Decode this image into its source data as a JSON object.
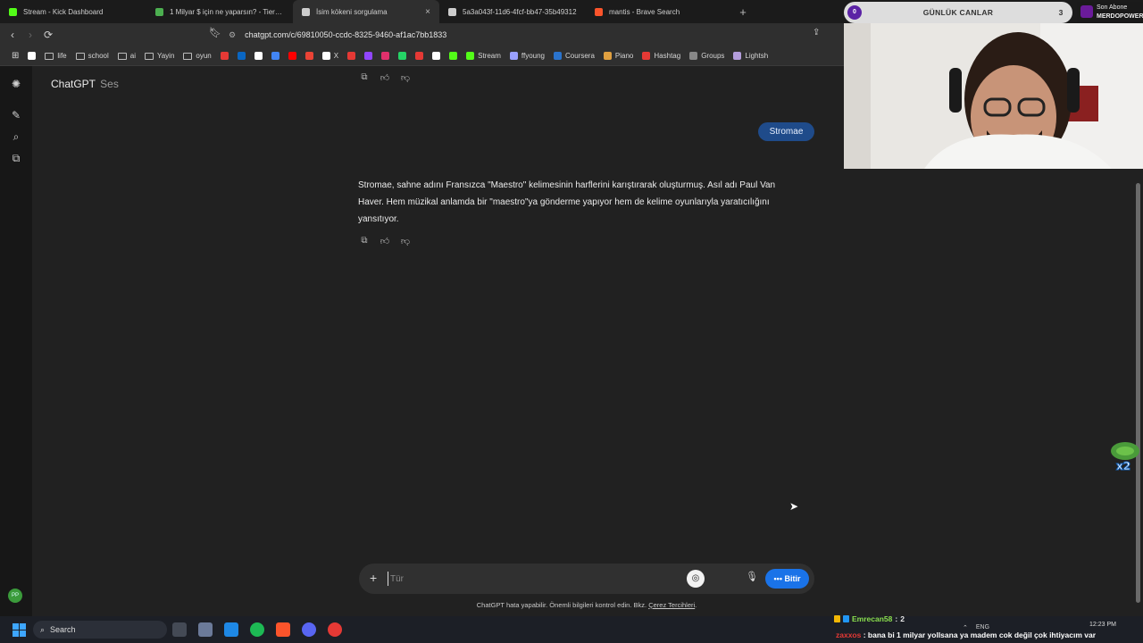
{
  "tabs": [
    {
      "label": "Stream - Kick Dashboard",
      "favicon_color": "#53fc18",
      "active": false
    },
    {
      "label": "1 Milyar $ için ne yaparsın? - Tier List",
      "favicon_color": "#4caf50",
      "active": false
    },
    {
      "label": "İsim kökeni sorgulama",
      "favicon_color": "#cccccc",
      "active": true
    },
    {
      "label": "5a3a043f-11d6-4fcf-bb47-35b49312",
      "favicon_color": "#cccccc",
      "active": false
    },
    {
      "label": "mantis - Brave Search",
      "favicon_color": "#fb542b",
      "active": false
    }
  ],
  "address_bar": {
    "url": "chatgpt.com/c/69810050-ccdc-8325-9460-af1ac7bb1833"
  },
  "bookmarks": [
    {
      "label": "",
      "icon": "google-icon",
      "color": "#ffffff"
    },
    {
      "label": "life",
      "icon": "folder-icon"
    },
    {
      "label": "school",
      "icon": "folder-icon"
    },
    {
      "label": "ai",
      "icon": "folder-icon"
    },
    {
      "label": "Yayin",
      "icon": "folder-icon"
    },
    {
      "label": "oyun",
      "icon": "folder-icon"
    },
    {
      "label": "",
      "icon": "red-dot-icon",
      "color": "#e53935"
    },
    {
      "label": "",
      "icon": "linkedin-icon",
      "color": "#0a66c2"
    },
    {
      "label": "",
      "icon": "google-icon",
      "color": "#ffffff"
    },
    {
      "label": "",
      "icon": "app-icon",
      "color": "#4285f4"
    },
    {
      "label": "",
      "icon": "youtube-icon",
      "color": "#ff0000"
    },
    {
      "label": "",
      "icon": "gmail-icon",
      "color": "#ea4335"
    },
    {
      "label": "X",
      "icon": "x-icon",
      "color": "#ffffff"
    },
    {
      "label": "",
      "icon": "red-icon",
      "color": "#e53935"
    },
    {
      "label": "",
      "icon": "twitch-icon",
      "color": "#9146ff"
    },
    {
      "label": "",
      "icon": "instagram-icon",
      "color": "#e1306c"
    },
    {
      "label": "",
      "icon": "whatsapp-icon",
      "color": "#25d366"
    },
    {
      "label": "",
      "icon": "tumblr-icon",
      "color": "#e53935"
    },
    {
      "label": "",
      "icon": "amazon-icon",
      "color": "#ffffff"
    },
    {
      "label": "",
      "icon": "kick-icon",
      "color": "#53fc18"
    },
    {
      "label": "Stream",
      "icon": "kick-icon",
      "color": "#53fc18"
    },
    {
      "label": "ffyoung",
      "icon": "app-icon",
      "color": "#9aa0ff"
    },
    {
      "label": "Coursera",
      "icon": "coursera-icon",
      "color": "#2a73cc"
    },
    {
      "label": "Piano",
      "icon": "app-icon",
      "color": "#e0a040"
    },
    {
      "label": "Hashtag",
      "icon": "red-icon",
      "color": "#e53935"
    },
    {
      "label": "Groups",
      "icon": "app-icon",
      "color": "#888888"
    },
    {
      "label": "Lightsh",
      "icon": "app-icon",
      "color": "#b39ddb"
    }
  ],
  "app": {
    "brand": "ChatGPT",
    "brand_sub": "Ses"
  },
  "conversation": {
    "user_message": "Stromae",
    "assistant_message": "Stromae, sahne adını Fransızca \"Maestro\" kelimesinin harflerini karıştırarak oluşturmuş. Asıl adı Paul Van Haver. Hem müzikal anlamda bir \"maestro\"ya gönderme yapıyor hem de kelime oyunlarıyla yaratıcılığını yansıtıyor."
  },
  "composer": {
    "placeholder": "Tür",
    "end_label": "Bitir"
  },
  "footer": {
    "disclaimer": "ChatGPT hata yapabilir. Önemli bilgileri kontrol edin. Bkz.",
    "link": "Çerez Tercihleri",
    "end": "."
  },
  "overlay": {
    "title": "GÜNLÜK CANLAR",
    "left_count": "0",
    "right_count": "3",
    "sub_title": "Son Abone",
    "sub_name": "MERDOPOWER"
  },
  "taskbar": {
    "search_label": "Search",
    "tray_lang": "ENG",
    "time": "12:23 PM"
  },
  "chat": [
    {
      "user": "Emrecan58",
      "sep": " : ",
      "text": "2"
    },
    {
      "user": "zaxxos",
      "sep": " : ",
      "text": "bana bi 1 milyar yollsana ya madem cok değil çok ihtiyacım var"
    }
  ]
}
